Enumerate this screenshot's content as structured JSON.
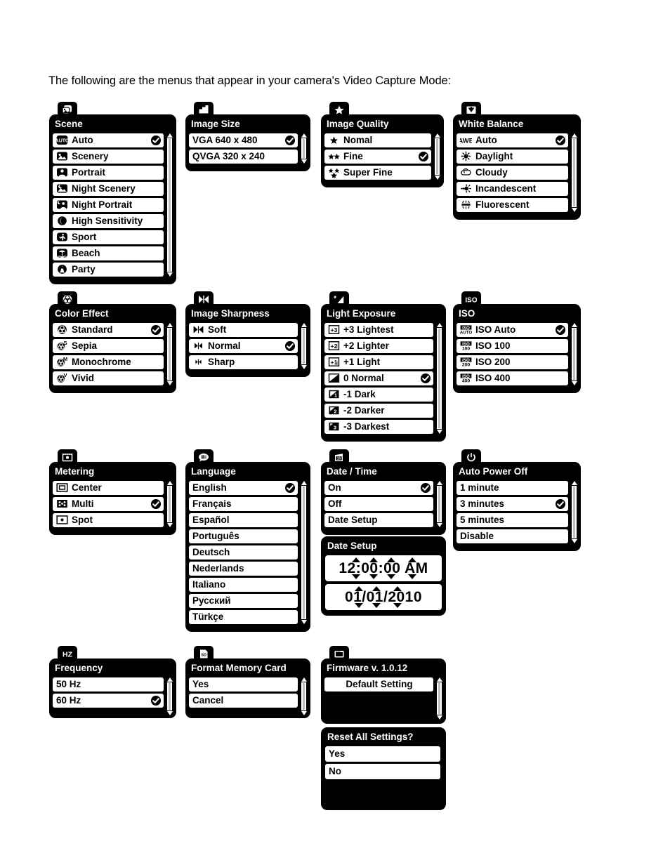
{
  "intro": "The following are the menus that appear in your camera's Video Capture Mode:",
  "colors": {
    "panel_bg": "#000000",
    "row_bg": "#ffffff",
    "text": "#000000",
    "title_text": "#ffffff",
    "scroll_thumb": "#bdbdbd"
  },
  "menus": {
    "scene": {
      "title": "Scene",
      "tab_icon": "scene-icon",
      "items": [
        {
          "label": "Auto",
          "icon": "auto-badge-icon",
          "selected": true
        },
        {
          "label": "Scenery",
          "icon": "scenery-icon",
          "selected": false
        },
        {
          "label": "Portrait",
          "icon": "portrait-icon",
          "selected": false
        },
        {
          "label": "Night Scenery",
          "icon": "night-scenery-icon",
          "selected": false
        },
        {
          "label": "Night Portrait",
          "icon": "night-portrait-icon",
          "selected": false
        },
        {
          "label": "High Sensitivity",
          "icon": "high-sensitivity-icon",
          "selected": false
        },
        {
          "label": "Sport",
          "icon": "sport-icon",
          "selected": false
        },
        {
          "label": "Beach",
          "icon": "beach-icon",
          "selected": false
        },
        {
          "label": "Party",
          "icon": "party-icon",
          "selected": false
        }
      ]
    },
    "image_size": {
      "title": "Image Size",
      "tab_icon": "image-size-icon",
      "items": [
        {
          "label": "VGA 640 x 480",
          "prefix": "VGA",
          "value": "640 x 480",
          "selected": true
        },
        {
          "label": "QVGA 320 x 240",
          "prefix": "QVGA",
          "value": "320 x 240",
          "selected": false
        }
      ]
    },
    "image_quality": {
      "title": "Image Quality",
      "tab_icon": "star-icon",
      "items": [
        {
          "label": "Nomal",
          "icon": "one-star-icon",
          "selected": false
        },
        {
          "label": "Fine",
          "icon": "two-star-icon",
          "selected": true
        },
        {
          "label": "Super Fine",
          "icon": "three-star-icon",
          "selected": false
        }
      ]
    },
    "white_balance": {
      "title": "White Balance",
      "tab_icon": "white-balance-icon",
      "items": [
        {
          "label": "Auto",
          "icon": "awb-icon",
          "selected": true
        },
        {
          "label": "Daylight",
          "icon": "sun-icon",
          "selected": false
        },
        {
          "label": "Cloudy",
          "icon": "cloud-icon",
          "selected": false
        },
        {
          "label": "Incandescent",
          "icon": "incandescent-icon",
          "selected": false
        },
        {
          "label": "Fluorescent",
          "icon": "fluorescent-icon",
          "selected": false
        }
      ]
    },
    "color_effect": {
      "title": "Color Effect",
      "tab_icon": "color-effect-icon",
      "items": [
        {
          "label": "Standard",
          "icon": "color-standard-icon",
          "selected": true
        },
        {
          "label": "Sepia",
          "icon": "color-sepia-icon",
          "selected": false
        },
        {
          "label": "Monochrome",
          "icon": "color-monochrome-icon",
          "selected": false
        },
        {
          "label": "Vivid",
          "icon": "color-vivid-icon",
          "selected": false
        }
      ]
    },
    "image_sharpness": {
      "title": "Image Sharpness",
      "tab_icon": "sharpness-icon",
      "items": [
        {
          "label": "Soft",
          "icon": "sharpness-soft-icon",
          "selected": false
        },
        {
          "label": "Normal",
          "icon": "sharpness-normal-icon",
          "selected": true
        },
        {
          "label": "Sharp",
          "icon": "sharpness-sharp-icon",
          "selected": false
        }
      ]
    },
    "light_exposure": {
      "title": "Light Exposure",
      "tab_icon": "exposure-icon",
      "items": [
        {
          "label": "+3 Lightest",
          "icon": "ev-plus3-icon",
          "badge": "+3",
          "selected": false
        },
        {
          "label": "+2 Lighter",
          "icon": "ev-plus2-icon",
          "badge": "+2",
          "selected": false
        },
        {
          "label": "+1 Light",
          "icon": "ev-plus1-icon",
          "badge": "+1",
          "selected": false
        },
        {
          "label": "0 Normal",
          "icon": "ev-zero-icon",
          "badge": "",
          "selected": true
        },
        {
          "label": "-1 Dark",
          "icon": "ev-minus1-icon",
          "badge": "1",
          "selected": false
        },
        {
          "label": "-2 Darker",
          "icon": "ev-minus2-icon",
          "badge": "2",
          "selected": false
        },
        {
          "label": "-3 Darkest",
          "icon": "ev-minus3-icon",
          "badge": "3",
          "selected": false
        }
      ]
    },
    "iso": {
      "title": "ISO",
      "tab_icon": "iso-icon",
      "items": [
        {
          "label": "ISO Auto",
          "icon": "iso-auto-icon",
          "sub": "AUTO",
          "selected": true
        },
        {
          "label": "ISO 100",
          "icon": "iso-100-icon",
          "sub": "100",
          "selected": false
        },
        {
          "label": "ISO 200",
          "icon": "iso-200-icon",
          "sub": "200",
          "selected": false
        },
        {
          "label": "ISO 400",
          "icon": "iso-400-icon",
          "sub": "400",
          "selected": false
        }
      ]
    },
    "metering": {
      "title": "Metering",
      "tab_icon": "metering-icon",
      "items": [
        {
          "label": "Center",
          "icon": "metering-center-icon",
          "selected": false
        },
        {
          "label": "Multi",
          "icon": "metering-multi-icon",
          "selected": true
        },
        {
          "label": "Spot",
          "icon": "metering-spot-icon",
          "selected": false
        }
      ]
    },
    "language": {
      "title": "Language",
      "tab_icon": "language-icon",
      "items": [
        {
          "label": "English",
          "selected": true
        },
        {
          "label": "Français",
          "selected": false
        },
        {
          "label": "Español",
          "selected": false
        },
        {
          "label": "Português",
          "selected": false
        },
        {
          "label": "Deutsch",
          "selected": false
        },
        {
          "label": "Nederlands",
          "selected": false
        },
        {
          "label": "Italiano",
          "selected": false
        },
        {
          "label": "Русский",
          "selected": false
        },
        {
          "label": "Türkçe",
          "selected": false
        }
      ]
    },
    "date_time": {
      "title": "Date / Time",
      "tab_icon": "calendar-icon",
      "items": [
        {
          "label": "On",
          "selected": true
        },
        {
          "label": "Off",
          "selected": false
        },
        {
          "label": "Date Setup",
          "selected": false
        }
      ]
    },
    "date_setup": {
      "title": "Date Setup",
      "time_value": "12:00:00 AM",
      "date_value": "01/01/2010"
    },
    "auto_power_off": {
      "title": "Auto Power Off",
      "tab_icon": "power-icon",
      "items": [
        {
          "label": "1 minute",
          "selected": false
        },
        {
          "label": "3 minutes",
          "selected": true
        },
        {
          "label": "5 minutes",
          "selected": false
        },
        {
          "label": "Disable",
          "selected": false
        }
      ]
    },
    "frequency": {
      "title": "Frequency",
      "tab_icon": "hz-icon",
      "items": [
        {
          "label": "50 Hz",
          "selected": false
        },
        {
          "label": "60 Hz",
          "selected": true
        }
      ]
    },
    "format_memory_card": {
      "title": "Format Memory Card",
      "tab_icon": "sd-card-icon",
      "items": [
        {
          "label": "Yes",
          "selected": false
        },
        {
          "label": "Cancel",
          "selected": false
        }
      ]
    },
    "firmware": {
      "title": "Firmware v. 1.0.12",
      "tab_icon": "firmware-icon",
      "items": [
        {
          "label": "Default Setting",
          "selected": false
        }
      ]
    },
    "reset_all": {
      "title": "Reset All Settings?",
      "items": [
        {
          "label": "Yes",
          "selected": false
        },
        {
          "label": "No",
          "selected": false
        }
      ]
    }
  }
}
